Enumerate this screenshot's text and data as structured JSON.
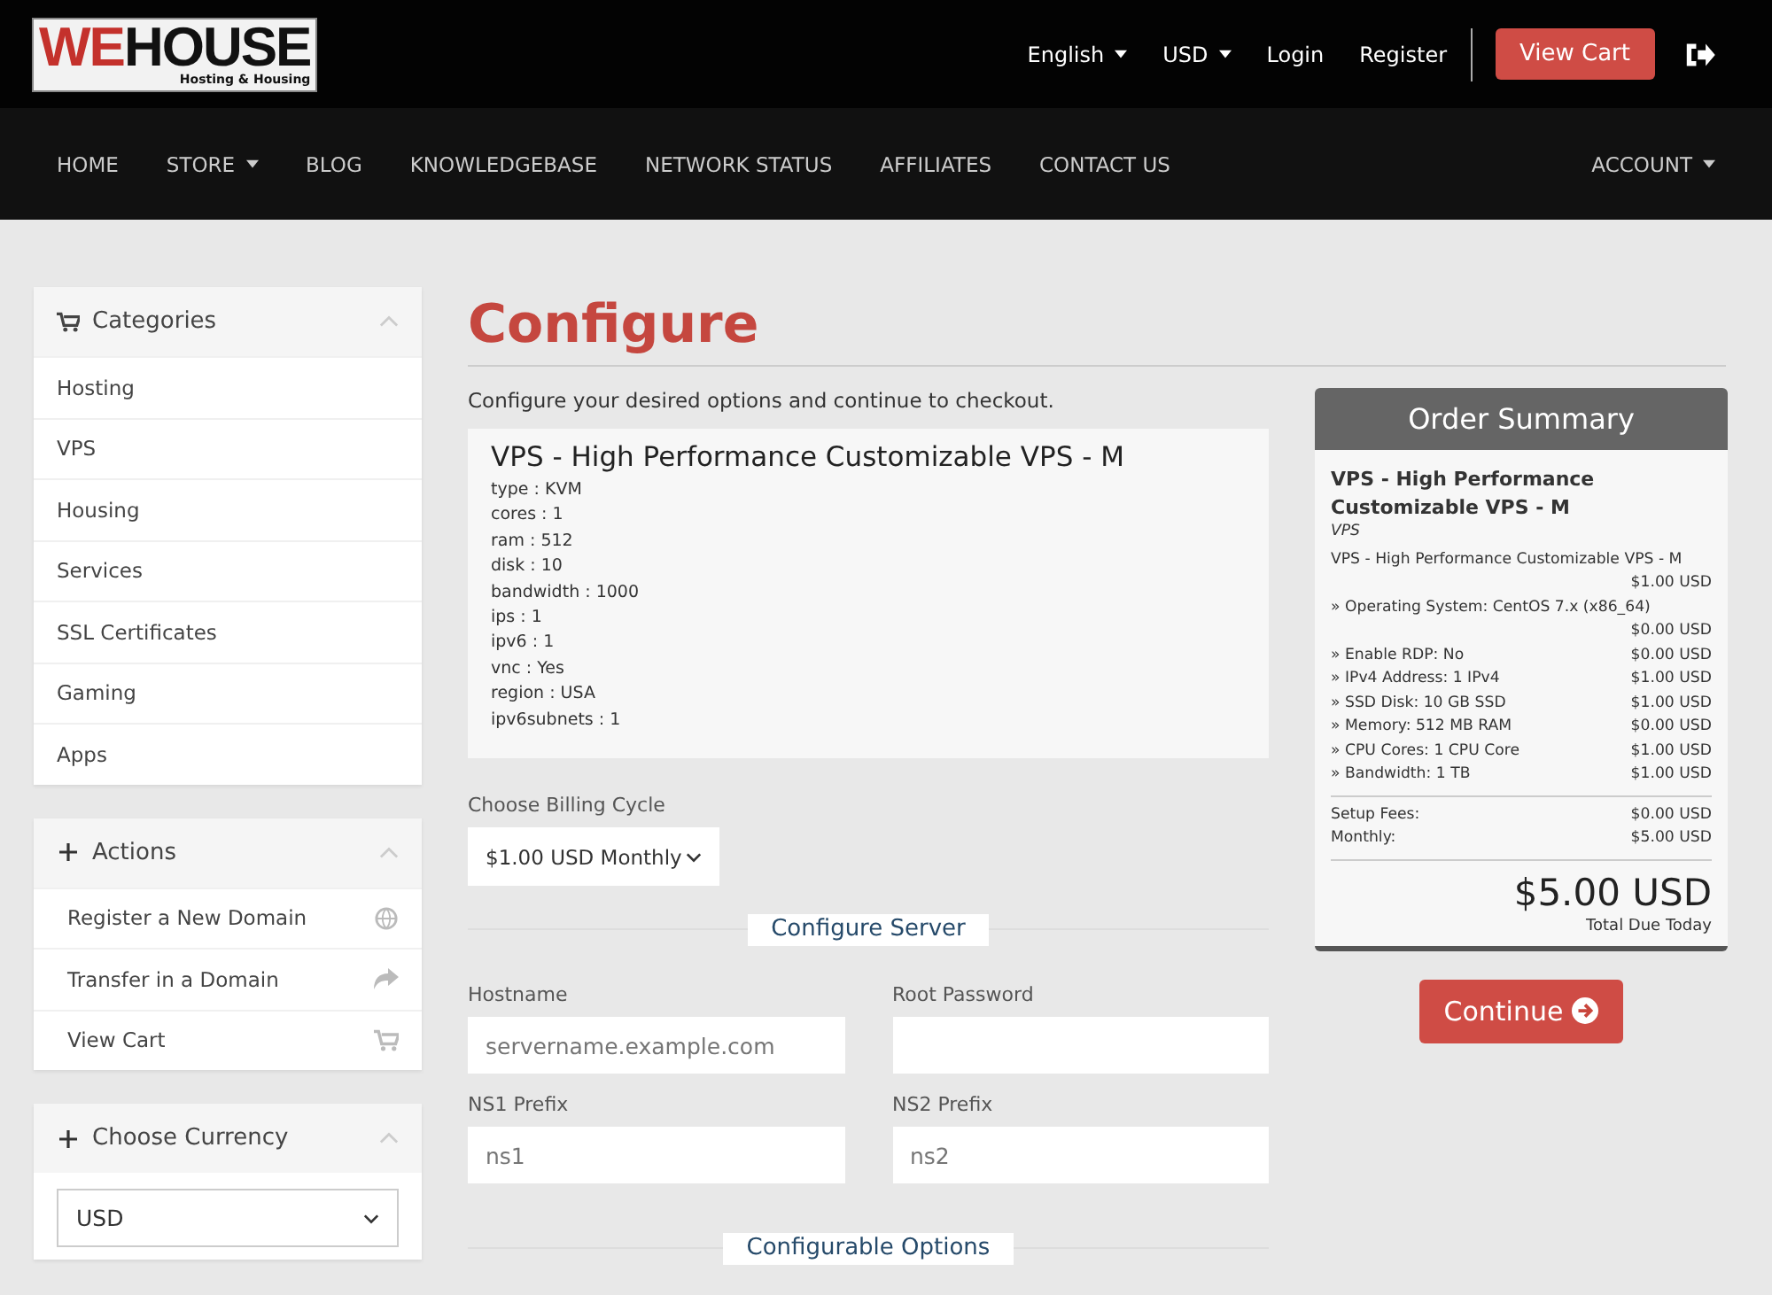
{
  "logo": {
    "part_1": "WE",
    "part_2": "HOUSE",
    "tagline": "Hosting & Housing"
  },
  "top_links": [
    {
      "label": "English",
      "dropdown": true
    },
    {
      "label": "USD",
      "dropdown": true
    },
    {
      "label": "Login",
      "dropdown": false
    },
    {
      "label": "Register",
      "dropdown": false
    }
  ],
  "cart_button": "View Cart",
  "nav": [
    {
      "label": "HOME",
      "dropdown": false
    },
    {
      "label": "STORE",
      "dropdown": true
    },
    {
      "label": "BLOG",
      "dropdown": false
    },
    {
      "label": "KNOWLEDGEBASE",
      "dropdown": false
    },
    {
      "label": "NETWORK STATUS",
      "dropdown": false
    },
    {
      "label": "AFFILIATES",
      "dropdown": false
    },
    {
      "label": "CONTACT US",
      "dropdown": false
    }
  ],
  "account": {
    "label": "ACCOUNT",
    "dropdown": true
  },
  "sidebar": [
    {
      "title": "Categories",
      "items": [
        {
          "label": "Hosting"
        },
        {
          "label": "VPS"
        },
        {
          "label": "Housing"
        },
        {
          "label": "Services"
        },
        {
          "label": "SSL Certificates"
        },
        {
          "label": "Gaming"
        },
        {
          "label": "Apps"
        }
      ]
    },
    {
      "title": "Actions",
      "items": [
        {
          "label": "Register a New Domain"
        },
        {
          "label": "Transfer in a Domain"
        },
        {
          "label": "View Cart"
        }
      ]
    },
    {
      "title": "Choose Currency",
      "select": "USD"
    }
  ],
  "page_title": "Configure",
  "intro": "Configure your desired options and continue to checkout.",
  "product": {
    "name": "VPS - High Performance Customizable VPS - M",
    "specs": [
      "type : KVM",
      "cores : 1",
      "ram : 512",
      "disk : 10",
      "bandwidth : 1000",
      "ips : 1",
      "ipv6 : 1",
      "vnc : Yes",
      "region : USA",
      "ipv6subnets : 1"
    ]
  },
  "billing": {
    "label": "Choose Billing Cycle",
    "value": "$1.00 USD Monthly"
  },
  "section_1": "Configure Server",
  "fields": [
    {
      "label": "Hostname",
      "placeholder": "servername.example.com"
    },
    {
      "label": "Root Password"
    },
    {
      "label": "NS1 Prefix",
      "placeholder": "ns1"
    },
    {
      "label": "NS2 Prefix",
      "placeholder": "ns2"
    }
  ],
  "section_2": "Configurable Options",
  "summary": {
    "title": "Order Summary",
    "product": "VPS - High Performance Customizable VPS - M",
    "group": "VPS",
    "line": "VPS - High Performance Customizable VPS - M",
    "line_price": "$1.00 USD",
    "options": [
      {
        "label": "» Operating System: CentOS 7.x (x86_64)",
        "price": "$0.00 USD"
      },
      {
        "label": "» Enable RDP: No",
        "price": "$0.00 USD"
      },
      {
        "label": "» IPv4 Address: 1 IPv4",
        "price": "$1.00 USD"
      },
      {
        "label": "» SSD Disk: 10 GB SSD",
        "price": "$1.00 USD"
      },
      {
        "label": "» Memory: 512 MB RAM",
        "price": "$0.00 USD"
      },
      {
        "label": "» CPU Cores: 1 CPU Core",
        "price": "$1.00 USD"
      },
      {
        "label": "» Bandwidth: 1 TB",
        "price": "$1.00 USD"
      }
    ],
    "fees": [
      {
        "label": "Setup Fees:",
        "price": "$0.00 USD"
      },
      {
        "label": "Monthly:",
        "price": "$5.00 USD"
      }
    ],
    "total": "$5.00 USD",
    "total_label": "Total Due Today"
  },
  "continue_button": "Continue"
}
